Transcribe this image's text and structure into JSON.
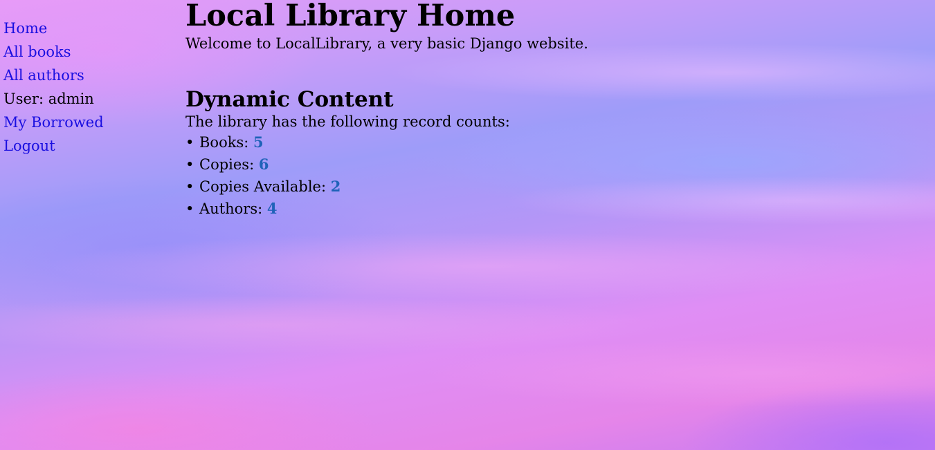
{
  "sidebar": {
    "home": "Home",
    "all_books": "All books",
    "all_authors": "All authors",
    "user": "User: admin",
    "my_borrowed": "My Borrowed",
    "logout": "Logout"
  },
  "main": {
    "title": "Local Library Home",
    "welcome": "Welcome to LocalLibrary, a very basic Django website.",
    "dynamic_heading": "Dynamic Content",
    "intro": "The library has the following record counts:",
    "counts": [
      {
        "label": "Books:",
        "value": "5"
      },
      {
        "label": "Copies:",
        "value": "6"
      },
      {
        "label": "Copies Available:",
        "value": "2"
      },
      {
        "label": "Authors:",
        "value": "4"
      }
    ]
  },
  "colors": {
    "link": "#1a0fe0",
    "count_value": "#1f62b8"
  }
}
